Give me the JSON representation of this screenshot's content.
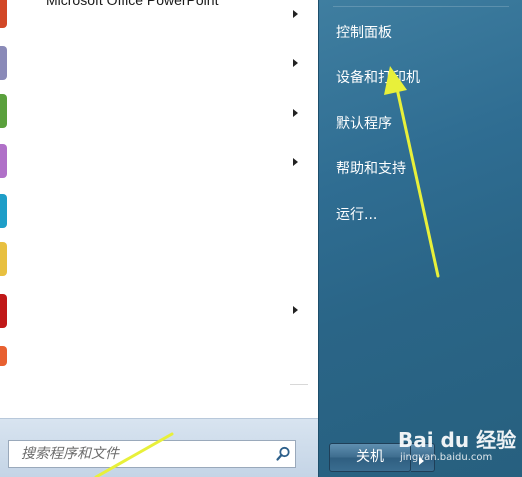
{
  "programs": {
    "items": [
      {
        "label": "Microsoft Office PowerPoint",
        "has_submenu": true,
        "icon": "powerpoint-icon",
        "color": "#d24726"
      },
      {
        "label": "",
        "has_submenu": true,
        "icon": "app-icon",
        "color": "#8a8ab8"
      },
      {
        "label": "",
        "has_submenu": true,
        "icon": "app-icon",
        "color": "#5aa03c"
      },
      {
        "label": "",
        "has_submenu": true,
        "icon": "app-icon",
        "color": "#b070c8"
      },
      {
        "label": "",
        "has_submenu": false,
        "icon": "app-icon",
        "color": "#1e9ec8"
      },
      {
        "label": "",
        "has_submenu": false,
        "icon": "app-icon",
        "color": "#e8c040"
      },
      {
        "label": "",
        "has_submenu": true,
        "icon": "app-icon",
        "color": "#c01818"
      },
      {
        "label": "",
        "has_submenu": false,
        "icon": "app-icon",
        "color": "#e86030"
      }
    ]
  },
  "search": {
    "placeholder": "搜索程序和文件"
  },
  "right_menu": {
    "items": [
      {
        "label": "控制面板"
      },
      {
        "label": "设备和打印机"
      },
      {
        "label": "默认程序"
      },
      {
        "label": "帮助和支持"
      },
      {
        "label": "运行..."
      }
    ]
  },
  "shutdown": {
    "label": "关机"
  },
  "watermark": {
    "main": "Bai du 经验",
    "sub": "jingyan.baidu.com"
  },
  "colors": {
    "right_pane": "#2f6d92",
    "annotation_arrow": "#e8f03a"
  }
}
